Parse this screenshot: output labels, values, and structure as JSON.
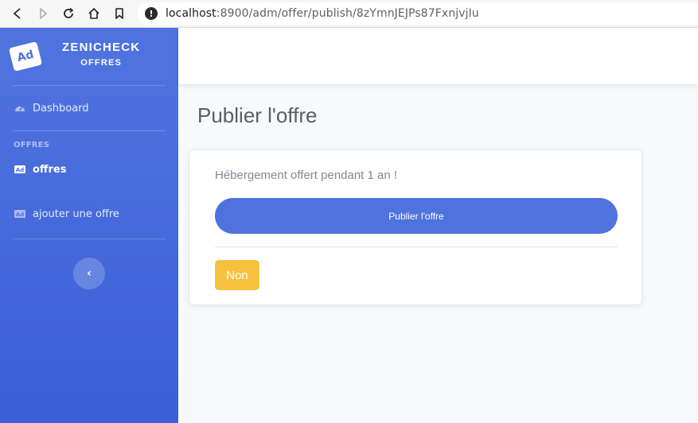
{
  "browser": {
    "url_host": "localhost",
    "url_rest": ":8900/adm/offer/publish/8zYmnJEJPs87FxnjvjIu"
  },
  "sidebar": {
    "brand_logo": "Ad",
    "brand_name": "ZENICHECK",
    "brand_sub": "OFFRES",
    "dashboard_label": "Dashboard",
    "section_heading": "OFFRES",
    "items": [
      {
        "label": "offres",
        "icon": "ad-icon",
        "active": true
      },
      {
        "label": "ajouter une offre",
        "icon": "ad-icon",
        "active": false
      }
    ],
    "toggle_glyph": "‹"
  },
  "main": {
    "page_title": "Publier l'offre",
    "card_text": "Hébergement offert pendant 1 an !",
    "publish_label": "Publier l'offre",
    "no_label": "Non"
  },
  "colors": {
    "primary": "#4e73df",
    "warning": "#f6c23e",
    "text_gray": "#858796",
    "title_gray": "#5a5c69"
  }
}
